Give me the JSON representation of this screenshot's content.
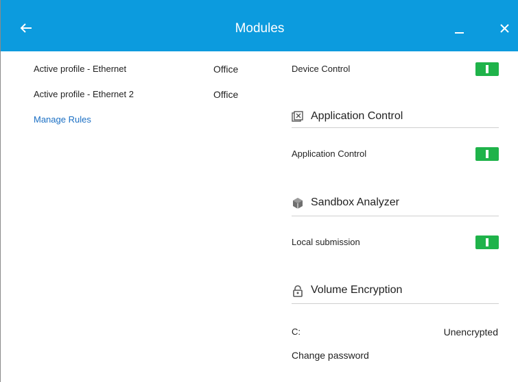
{
  "window": {
    "title": "Modules"
  },
  "firewall": {
    "rows": [
      {
        "label": "Active profile - Ethernet",
        "value": "Office"
      },
      {
        "label": "Active profile - Ethernet 2",
        "value": "Office"
      }
    ],
    "manage_rules_link": "Manage Rules"
  },
  "device_control": {
    "label": "Device Control",
    "enabled": true
  },
  "application_control": {
    "section_title": "Application Control",
    "section_icon": "application-control-icon",
    "label": "Application Control",
    "enabled": true
  },
  "sandbox_analyzer": {
    "section_title": "Sandbox Analyzer",
    "section_icon": "sandbox-cube-icon",
    "label": "Local submission",
    "enabled": true
  },
  "volume_encryption": {
    "section_title": "Volume Encryption",
    "section_icon": "padlock-icon",
    "drive_label": "C:",
    "drive_status": "Unencrypted",
    "change_password_link": "Change password"
  },
  "colors": {
    "titlebar": "#0c9bde",
    "toggle_on": "#1fb34a",
    "link": "#1a6fc4"
  }
}
